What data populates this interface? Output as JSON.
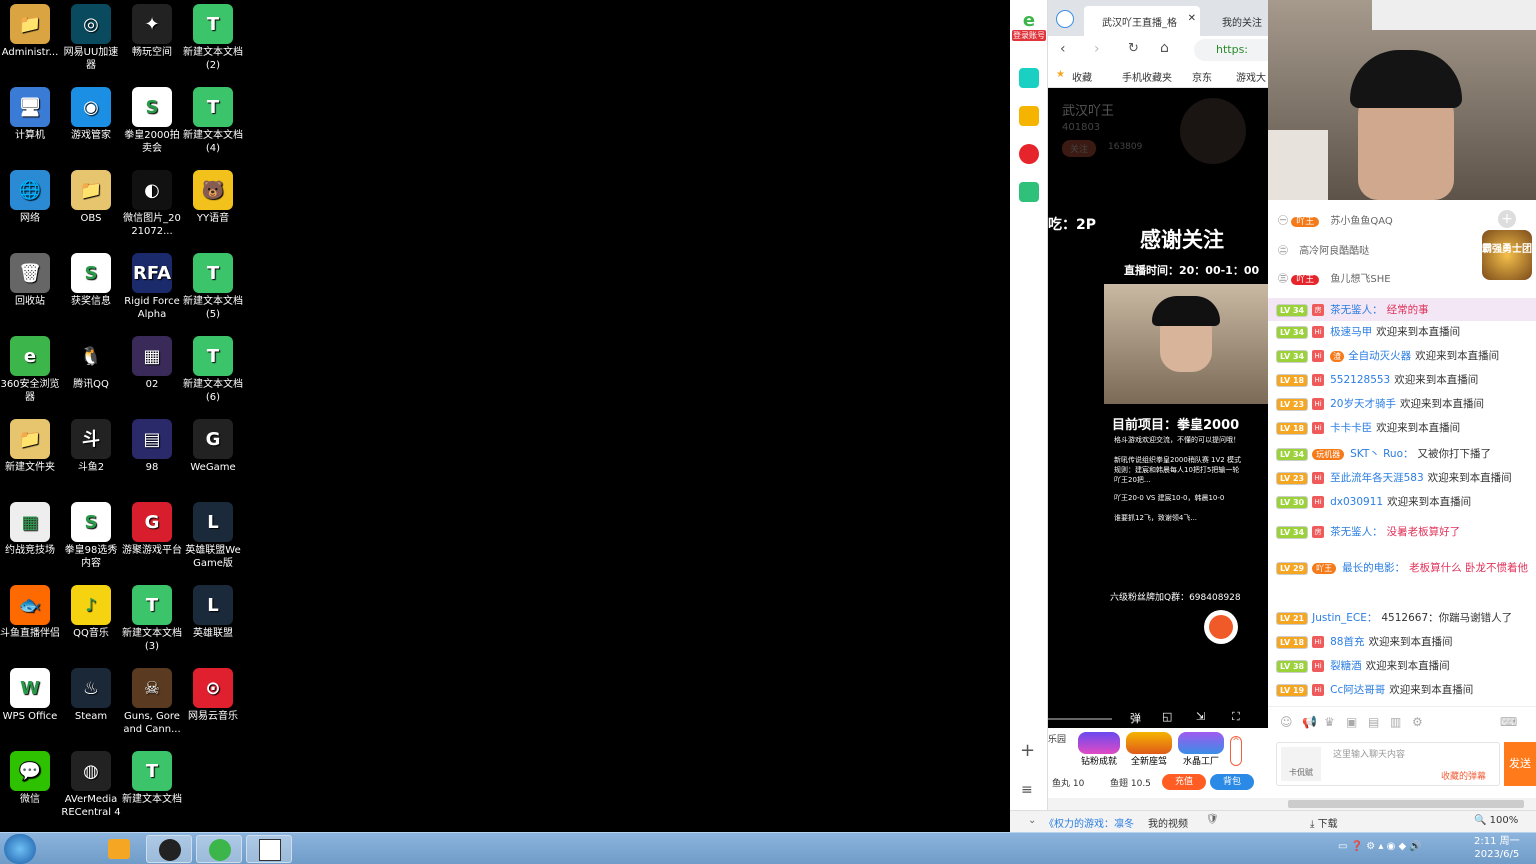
{
  "desktop_icons": [
    {
      "label": "Administr...",
      "icon": "folder-user-icon",
      "color": "#d9a441",
      "glyph": "📁"
    },
    {
      "label": "网易UU加速器",
      "icon": "uu-accelerator-icon",
      "color": "#0a4a5e",
      "glyph": "◎"
    },
    {
      "label": "畅玩空间",
      "icon": "play-space-icon",
      "color": "#222",
      "glyph": "✦"
    },
    {
      "label": "新建文本文档 (2)",
      "icon": "text-doc-icon",
      "color": "#3cc46a",
      "glyph": "T"
    },
    {
      "label": "计算机",
      "icon": "computer-icon",
      "color": "#3a7bd5",
      "glyph": "🖥"
    },
    {
      "label": "游戏管家",
      "icon": "game-manager-icon",
      "color": "#1a8fe3",
      "glyph": "◉"
    },
    {
      "label": "拳皇2000拍卖会",
      "icon": "wps-doc-icon",
      "color": "#fff",
      "glyph": "S"
    },
    {
      "label": "新建文本文档 (4)",
      "icon": "text-doc-icon",
      "color": "#3cc46a",
      "glyph": "T"
    },
    {
      "label": "网络",
      "icon": "network-icon",
      "color": "#2a8ad4",
      "glyph": "🌐"
    },
    {
      "label": "OBS",
      "icon": "folder-icon",
      "color": "#e6c56e",
      "glyph": "📁"
    },
    {
      "label": "微信图片_2021072...",
      "icon": "image-file-icon",
      "color": "#111",
      "glyph": "◐"
    },
    {
      "label": "YY语音",
      "icon": "yy-voice-icon",
      "color": "#f2c11b",
      "glyph": "🐻"
    },
    {
      "label": "回收站",
      "icon": "recycle-bin-icon",
      "color": "#666",
      "glyph": "🗑"
    },
    {
      "label": "获奖信息",
      "icon": "wps-doc-icon",
      "color": "#fff",
      "glyph": "S"
    },
    {
      "label": "Rigid Force Alpha",
      "icon": "rigid-force-icon",
      "color": "#1a2a6a",
      "glyph": "RFA"
    },
    {
      "label": "新建文本文档 (5)",
      "icon": "text-doc-icon",
      "color": "#3cc46a",
      "glyph": "T"
    },
    {
      "label": "360安全浏览器",
      "icon": "browser-360-icon",
      "color": "#3cb54a",
      "glyph": "e"
    },
    {
      "label": "腾讯QQ",
      "icon": "qq-icon",
      "color": "#000",
      "glyph": "🐧"
    },
    {
      "label": "02",
      "icon": "image-file-icon",
      "color": "#3a2a5a",
      "glyph": "▦"
    },
    {
      "label": "新建文本文档 (6)",
      "icon": "text-doc-icon",
      "color": "#3cc46a",
      "glyph": "T"
    },
    {
      "label": "新建文件夹",
      "icon": "folder-icon",
      "color": "#e6c56e",
      "glyph": "📁"
    },
    {
      "label": "斗鱼2",
      "icon": "douyu-file-icon",
      "color": "#222",
      "glyph": "斗"
    },
    {
      "label": "98",
      "icon": "image-file-icon",
      "color": "#2a2a6a",
      "glyph": "▤"
    },
    {
      "label": "WeGame",
      "icon": "wegame-icon",
      "color": "#222",
      "glyph": "G"
    },
    {
      "label": "约战竞技场",
      "icon": "arena-icon",
      "color": "#eee",
      "glyph": "▦"
    },
    {
      "label": "拳皇98选秀内容",
      "icon": "wps-doc-icon",
      "color": "#fff",
      "glyph": "S"
    },
    {
      "label": "游聚游戏平台",
      "icon": "youju-icon",
      "color": "#d81e2c",
      "glyph": "G"
    },
    {
      "label": "英雄联盟WeGame版",
      "icon": "lol-icon",
      "color": "#1a2a3a",
      "glyph": "L"
    },
    {
      "label": "斗鱼直播伴侣",
      "icon": "douyu-companion-icon",
      "color": "#ff6a00",
      "glyph": "🐟"
    },
    {
      "label": "QQ音乐",
      "icon": "qq-music-icon",
      "color": "#f5d311",
      "glyph": "♪"
    },
    {
      "label": "新建文本文档 (3)",
      "icon": "text-doc-icon",
      "color": "#3cc46a",
      "glyph": "T"
    },
    {
      "label": "英雄联盟",
      "icon": "lol-icon",
      "color": "#1a2a3a",
      "glyph": "L"
    },
    {
      "label": "WPS Office",
      "icon": "wps-office-icon",
      "color": "#fff",
      "glyph": "W"
    },
    {
      "label": "Steam",
      "icon": "steam-icon",
      "color": "#1b2838",
      "glyph": "♨"
    },
    {
      "label": "Guns, Gore and Cann...",
      "icon": "guns-gore-icon",
      "color": "#5a3a20",
      "glyph": "☠"
    },
    {
      "label": "网易云音乐",
      "icon": "netease-music-icon",
      "color": "#e0202f",
      "glyph": "⊙"
    },
    {
      "label": "微信",
      "icon": "wechat-icon",
      "color": "#2dc100",
      "glyph": "💬"
    },
    {
      "label": "AVerMedia RECentral 4",
      "icon": "avermedia-icon",
      "color": "#222",
      "glyph": "◍"
    },
    {
      "label": "新建文本文档",
      "icon": "text-doc-icon",
      "color": "#3cc46a",
      "glyph": "T"
    }
  ],
  "browser": {
    "login_label": "登录账号",
    "tabs": [
      "武汉吖王直播_格",
      "我的关注"
    ],
    "address": "https:",
    "bookmarks": [
      "收藏",
      "手机收藏夹",
      "京东",
      "游戏大"
    ],
    "streamer": {
      "name": "武汉吖王",
      "fans": "401803",
      "follow": "关注",
      "follow_count": "163809"
    },
    "overlay": {
      "side_text": "吃：2P",
      "thanks": "感谢关注",
      "schedule": "直播时间：20：00-1：00",
      "project": "目前项目：拳皇2000",
      "line1": "格斗游戏欢迎交流，不懂的可以提问哦！",
      "line2": "新吼传说组织拳皇2000稍队赛 1V2 模式",
      "line3": "规则：建宸和韩晨每人10把打5把输一轮",
      "line4": "吖王20把...",
      "line5": "吖王20-0 VS 建宸10-0，韩晨10-0",
      "line6": "谁要抓12飞，致谢领4飞...",
      "qq_group": "六级粉丝牌加Q群：698408928"
    },
    "gifts": [
      "乐园",
      "钻粉成就",
      "全新座驾",
      "水晶工厂"
    ],
    "wallet": {
      "fish_ball": "鱼丸 10",
      "fish_fin": "鱼翅 10.5",
      "recharge": "充值",
      "backpack": "背包"
    },
    "status": {
      "drama": "《权力的游戏：凛冬",
      "my_video": "我的视频",
      "download": "下载",
      "zoom": "100%"
    }
  },
  "fans": [
    {
      "badge": "吖王",
      "name": "苏小鱼鱼QAQ"
    },
    {
      "badge": "",
      "name": "高冷阿良酷酷哒"
    },
    {
      "badge": "吖王",
      "name": "鱼儿想飞SHE"
    }
  ],
  "fan_club": "霸强勇士团",
  "chat": [
    {
      "lv": "LV 34",
      "lvc": "#9bd23a",
      "tag": "房",
      "user": "茶无鉴人：",
      "text": "经常的事",
      "hl": true,
      "color": "#e0335a"
    },
    {
      "lv": "LV 34",
      "lvc": "#9bd23a",
      "tag": "Hi",
      "user": "极速马甲",
      "text": "欢迎来到本直播间"
    },
    {
      "lv": "LV 34",
      "lvc": "#9bd23a",
      "tag": "Hi",
      "user": "全自动灭火器",
      "text": "欢迎来到本直播间",
      "badge": "渣"
    },
    {
      "lv": "LV 18",
      "lvc": "#f5a623",
      "tag": "Hi",
      "user": "552128553",
      "text": "欢迎来到本直播间"
    },
    {
      "lv": "LV 23",
      "lvc": "#f5a623",
      "tag": "Hi",
      "user": "20岁天才骑手",
      "text": "欢迎来到本直播间"
    },
    {
      "lv": "LV 18",
      "lvc": "#f5a623",
      "tag": "Hi",
      "user": "卡卡卡臣",
      "text": "欢迎来到本直播间"
    },
    {
      "lv": "LV 34",
      "lvc": "#9bd23a",
      "tag": "玩机器",
      "user": "SKT丶 Ruo：",
      "text": "又被你打下播了",
      "badge2": true
    },
    {
      "lv": "LV 23",
      "lvc": "#f5a623",
      "tag": "Hi",
      "user": "至此流年各天涯583",
      "text": "欢迎来到本直播间"
    },
    {
      "lv": "LV 30",
      "lvc": "#9bd23a",
      "tag": "Hi",
      "user": "dx030911",
      "text": "欢迎来到本直播间"
    },
    {
      "lv": "LV 34",
      "lvc": "#9bd23a",
      "tag": "房",
      "user": "茶无鉴人：",
      "text": "没暑老板算好了",
      "color": "#e0335a"
    },
    {
      "lv": "LV 29",
      "lvc": "#f5a623",
      "tag": "吖王",
      "user": "最长的电影：",
      "text": "老板算什么 卧龙不惯着他",
      "color": "#e0335a"
    },
    {
      "lv": "LV 21",
      "lvc": "#f5a623",
      "tag": "",
      "user": "Justin_ECE：",
      "text": "4512667：你踹马谢错人了"
    },
    {
      "lv": "LV 18",
      "lvc": "#f5a623",
      "tag": "Hi",
      "user": "88首充",
      "text": "欢迎来到本直播间"
    },
    {
      "lv": "LV 38",
      "lvc": "#9bd23a",
      "tag": "Hi",
      "user": "裂糖酒",
      "text": "欢迎来到本直播间"
    },
    {
      "lv": "LV 19",
      "lvc": "#f5a623",
      "tag": "Hi",
      "user": "Cc阿达哥哥",
      "text": "欢迎来到本直播间"
    }
  ],
  "input": {
    "placeholder": "这里输入聊天内容",
    "hint": "收藏的弹幕",
    "send": "发送",
    "avatar": "卡侃赋"
  },
  "taskbar": {
    "time": "2:11 周一",
    "date": "2023/6/5"
  }
}
